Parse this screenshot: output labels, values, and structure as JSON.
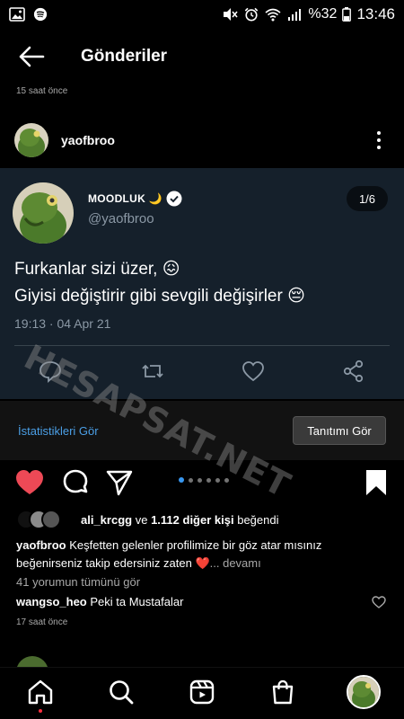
{
  "status_bar": {
    "battery": "%32",
    "time": "13:46"
  },
  "header": {
    "title": "Gönderiler"
  },
  "prev_post_time": "15 saat önce",
  "post": {
    "username": "yaofbroo",
    "tweet": {
      "display_name": "MOODLUK 🌙",
      "handle": "@yaofbroo",
      "counter": "1/6",
      "line1": "Furkanlar sizi üzer, 😖",
      "line2": "Giyisi değiştirir gibi sevgili değişirler 😔",
      "date": "19:13 · 04 Apr 21"
    },
    "insights_link": "İstatistikleri Gör",
    "promote_button": "Tanıtımı Gör",
    "carousel": {
      "count": 6,
      "active": 0
    },
    "likes": {
      "user": "ali_krcgg",
      "middle": "ve",
      "others": "1.112 diğer kişi",
      "suffix": "beğendi"
    },
    "caption": {
      "user": "yaofbroo",
      "text": "Keşfetten gelenler profilimize bir göz atar mısınız beğenirseniz takip edersiniz zaten ❤️",
      "more": "... devamı"
    },
    "view_all_comments": "41 yorumun tümünü gör",
    "comment": {
      "user": "wangso_heo",
      "text": "Peki ta Mustafalar"
    },
    "time_ago": "17 saat önce"
  },
  "watermark": "HESAPSAT.NET",
  "colors": {
    "accent_blue": "#4b9fe6",
    "like_red": "#ed4956",
    "tweet_bg": "#15202b",
    "dot_blue": "#3897f0"
  }
}
